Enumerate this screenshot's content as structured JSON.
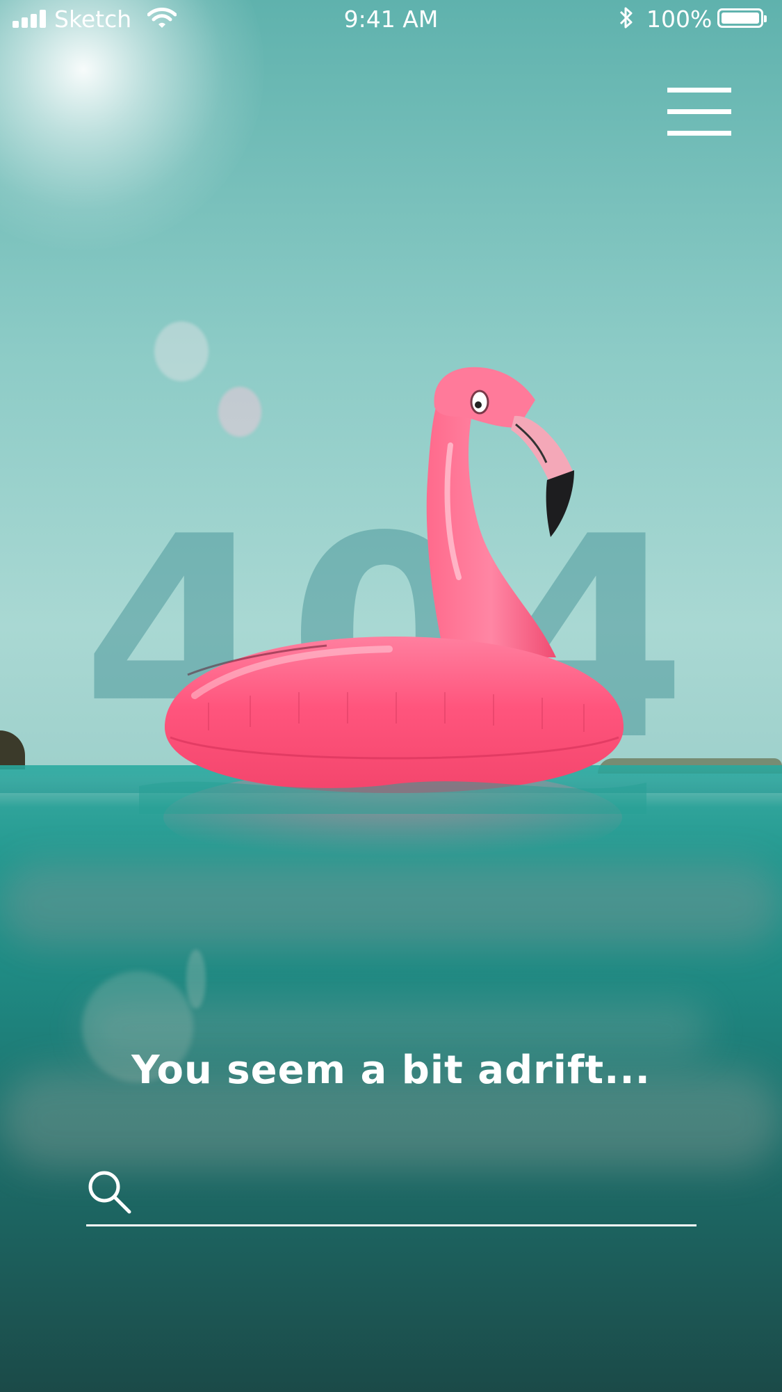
{
  "status_bar": {
    "carrier": "Sketch",
    "time": "9:41 AM",
    "battery_percent": "100%",
    "battery_level": 1.0,
    "icons": [
      "signal-icon",
      "wifi-icon",
      "bluetooth-icon",
      "battery-icon"
    ]
  },
  "header": {
    "menu_icon": "hamburger-menu-icon"
  },
  "hero": {
    "background_number": "404",
    "image": "pink-flamingo-float-on-water"
  },
  "message": {
    "headline": "You seem a bit adrift..."
  },
  "search": {
    "icon": "search-icon",
    "value": "",
    "placeholder": ""
  },
  "colors": {
    "text": "#ffffff",
    "flamingo_pink": "#ff4f7a",
    "water": "#1f8a83"
  }
}
